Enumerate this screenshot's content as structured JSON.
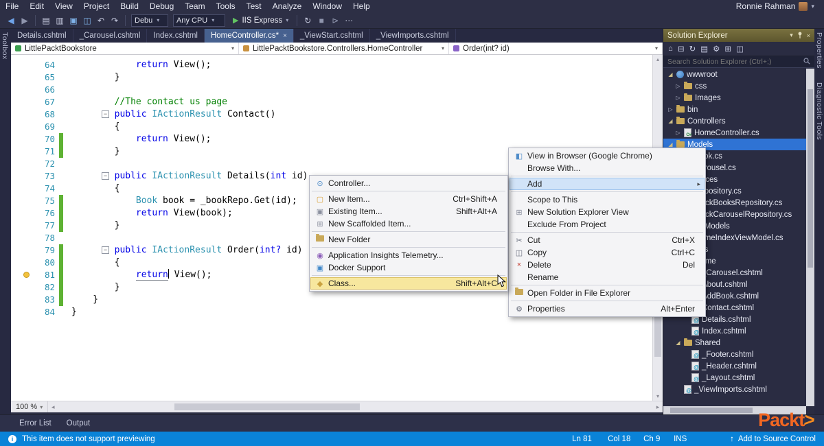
{
  "window": {
    "user_name": "Ronnie Rahman"
  },
  "menubar": [
    "File",
    "Edit",
    "View",
    "Project",
    "Build",
    "Debug",
    "Team",
    "Tools",
    "Test",
    "Analyze",
    "Window",
    "Help"
  ],
  "toolbar": {
    "nav_icons": [
      {
        "n": "back-icon",
        "g": "◀",
        "c": "#6fa3e8"
      },
      {
        "n": "forward-icon",
        "g": "▶",
        "c": "#8f95ad"
      }
    ],
    "file_icons": [
      {
        "n": "new-file-icon",
        "g": "▤",
        "c": "#c7cbe0"
      },
      {
        "n": "open-file-icon",
        "g": "▥",
        "c": "#c7cbe0"
      },
      {
        "n": "save-icon",
        "g": "▣",
        "c": "#7fb2e8"
      },
      {
        "n": "save-all-icon",
        "g": "◫",
        "c": "#7fb2e8"
      },
      {
        "n": "undo-icon",
        "g": "↶",
        "c": "#c7cbe0"
      },
      {
        "n": "redo-icon",
        "g": "↷",
        "c": "#c7cbe0"
      }
    ],
    "debug_config": "Debu",
    "platform": "Any CPU",
    "run_label": "IIS Express",
    "tail_icons": [
      {
        "n": "refresh-icon",
        "g": "↻",
        "c": "#c7cbe0"
      },
      {
        "n": "stop-icon",
        "g": "■",
        "c": "#8f95ad"
      },
      {
        "n": "step-icon",
        "g": "⊳",
        "c": "#8f95ad"
      },
      {
        "n": "more-tools-icon",
        "g": "⋯",
        "c": "#c7cbe0"
      }
    ]
  },
  "tabs": [
    {
      "label": "Details.cshtml",
      "active": false
    },
    {
      "label": "_Carousel.cshtml",
      "active": false
    },
    {
      "label": "Index.cshtml",
      "active": false
    },
    {
      "label": "HomeController.cs*",
      "active": true
    },
    {
      "label": "_ViewStart.cshtml",
      "active": false
    },
    {
      "label": "_ViewImports.cshtml",
      "active": false
    }
  ],
  "breadcrumb": {
    "segments": [
      {
        "label": "LittlePacktBookstore",
        "icon": "project-icon",
        "c": "#3b9e4f"
      },
      {
        "label": "LittlePacktBookstore.Controllers.HomeController",
        "icon": "class-icon",
        "c": "#c9913f"
      },
      {
        "label": "Order(int? id)",
        "icon": "method-icon",
        "c": "#8a63c8"
      }
    ]
  },
  "editor": {
    "zoom": "100 %",
    "lines": [
      {
        "n": 64,
        "segs": [
          [
            "p",
            "            "
          ],
          [
            "k",
            "return"
          ],
          [
            "p",
            " View();"
          ]
        ]
      },
      {
        "n": 65,
        "segs": [
          [
            "p",
            "        }"
          ]
        ]
      },
      {
        "n": 66,
        "segs": []
      },
      {
        "n": 67,
        "segs": [
          [
            "p",
            "        "
          ],
          [
            "c",
            "//The contact us page"
          ]
        ]
      },
      {
        "n": 68,
        "outline": true,
        "segs": [
          [
            "p",
            "        "
          ],
          [
            "k",
            "public"
          ],
          [
            "p",
            " "
          ],
          [
            "t",
            "IActionResult"
          ],
          [
            "p",
            " Contact()"
          ]
        ]
      },
      {
        "n": 69,
        "segs": [
          [
            "p",
            "        {"
          ]
        ]
      },
      {
        "n": 70,
        "bar": "g",
        "segs": [
          [
            "p",
            "            "
          ],
          [
            "k",
            "return"
          ],
          [
            "p",
            " View();"
          ]
        ]
      },
      {
        "n": 71,
        "bar": "g",
        "segs": [
          [
            "p",
            "        }"
          ]
        ]
      },
      {
        "n": 72,
        "segs": []
      },
      {
        "n": 73,
        "outline": true,
        "segs": [
          [
            "p",
            "        "
          ],
          [
            "k",
            "public"
          ],
          [
            "p",
            " "
          ],
          [
            "t",
            "IActionResult"
          ],
          [
            "p",
            " Details("
          ],
          [
            "k",
            "int"
          ],
          [
            "p",
            " id)"
          ]
        ]
      },
      {
        "n": 74,
        "segs": [
          [
            "p",
            "        {"
          ]
        ]
      },
      {
        "n": 75,
        "bar": "g",
        "segs": [
          [
            "p",
            "            "
          ],
          [
            "t",
            "Book"
          ],
          [
            "p",
            " book = _bookRepo.Get(id);"
          ]
        ]
      },
      {
        "n": 76,
        "bar": "g",
        "segs": [
          [
            "p",
            "            "
          ],
          [
            "k",
            "return"
          ],
          [
            "p",
            " View(book);"
          ]
        ]
      },
      {
        "n": 77,
        "bar": "g",
        "segs": [
          [
            "p",
            "        }"
          ]
        ]
      },
      {
        "n": 78,
        "segs": []
      },
      {
        "n": 79,
        "outline": true,
        "bar": "g",
        "segs": [
          [
            "p",
            "        "
          ],
          [
            "k",
            "public"
          ],
          [
            "p",
            " "
          ],
          [
            "t",
            "IActionResult"
          ],
          [
            "p",
            " Order("
          ],
          [
            "k",
            "int?"
          ],
          [
            "p",
            " id)"
          ]
        ]
      },
      {
        "n": 80,
        "bar": "g",
        "segs": [
          [
            "p",
            "        {"
          ]
        ]
      },
      {
        "n": 81,
        "bar": "g",
        "bulb": true,
        "segs": [
          [
            "p",
            "            "
          ],
          [
            "ku",
            "return"
          ],
          [
            "p",
            " View();"
          ]
        ]
      },
      {
        "n": 82,
        "bar": "g",
        "segs": [
          [
            "p",
            "        }"
          ]
        ]
      },
      {
        "n": 83,
        "bar": "g",
        "segs": [
          [
            "p",
            "    }"
          ]
        ]
      },
      {
        "n": 84,
        "segs": [
          [
            "p",
            "}"
          ]
        ]
      }
    ]
  },
  "context_menu": {
    "items": [
      {
        "label": "View in Browser (Google Chrome)",
        "icon": "browser-icon",
        "g": "◧",
        "c": "#4f8cc9"
      },
      {
        "label": "Browse With..."
      },
      {
        "sep": true
      },
      {
        "label": "Add",
        "submenu": true,
        "highlight": "blue"
      },
      {
        "sep": true
      },
      {
        "label": "Scope to This"
      },
      {
        "label": "New Solution Explorer View",
        "icon": "new-view-icon",
        "g": "⊞",
        "c": "#8a8f9e"
      },
      {
        "label": "Exclude From Project"
      },
      {
        "sep": true
      },
      {
        "label": "Cut",
        "shortcut": "Ctrl+X",
        "icon": "cut-icon",
        "g": "✂",
        "c": "#6a6f7e"
      },
      {
        "label": "Copy",
        "shortcut": "Ctrl+C",
        "icon": "copy-icon",
        "g": "◫",
        "c": "#6a6f7e"
      },
      {
        "label": "Delete",
        "shortcut": "Del",
        "icon": "delete-icon",
        "g": "×",
        "c": "#c0392b"
      },
      {
        "label": "Rename"
      },
      {
        "sep": true
      },
      {
        "label": "Open Folder in File Explorer",
        "icon": "open-folder-icon",
        "folder": true
      },
      {
        "sep": true
      },
      {
        "label": "Properties",
        "shortcut": "Alt+Enter",
        "icon": "properties-icon",
        "g": "⚙",
        "c": "#6a6f7e"
      }
    ]
  },
  "add_submenu": {
    "items": [
      {
        "label": "Controller...",
        "icon": "controller-icon",
        "g": "⊙",
        "c": "#4f8cc9"
      },
      {
        "sep": true
      },
      {
        "label": "New Item...",
        "shortcut": "Ctrl+Shift+A",
        "icon": "new-item-icon",
        "g": "▢",
        "c": "#d8a13a"
      },
      {
        "label": "Existing Item...",
        "shortcut": "Shift+Alt+A",
        "icon": "existing-item-icon",
        "g": "▣",
        "c": "#8a8f9e"
      },
      {
        "label": "New Scaffolded Item...",
        "icon": "scaffolded-item-icon",
        "g": "⊞",
        "c": "#8a8f9e"
      },
      {
        "sep": true
      },
      {
        "label": "New Folder",
        "icon": "new-folder-icon",
        "folder": true
      },
      {
        "sep": true
      },
      {
        "label": "Application Insights Telemetry...",
        "icon": "app-insights-icon",
        "g": "◉",
        "c": "#8a5bb8"
      },
      {
        "label": "Docker Support",
        "icon": "docker-icon",
        "g": "▣",
        "c": "#3f87c9"
      },
      {
        "sep": true
      },
      {
        "label": "Class...",
        "shortcut": "Shift+Alt+C",
        "icon": "class-icon",
        "g": "◆",
        "c": "#caa23f",
        "highlight": "gold"
      }
    ]
  },
  "solution_explorer": {
    "title": "Solution Explorer",
    "search_placeholder": "Search Solution Explorer (Ctrl+;)",
    "toolbar_icons": [
      {
        "n": "home-icon",
        "g": "⌂"
      },
      {
        "n": "collapse-all-icon",
        "g": "⊟"
      },
      {
        "n": "sync-with-active-document-icon",
        "g": "↻"
      },
      {
        "n": "show-all-files-icon",
        "g": "▤"
      },
      {
        "n": "properties-icon",
        "g": "⚙"
      },
      {
        "n": "new-view-icon",
        "g": "⊞"
      },
      {
        "n": "pending-changes-icon",
        "g": "◫"
      }
    ],
    "tree": [
      {
        "label": "wwwroot",
        "depth": 0,
        "icon": "globe",
        "arrow": "e"
      },
      {
        "label": "css",
        "depth": 1,
        "icon": "folder",
        "arrow": "c"
      },
      {
        "label": "Images",
        "depth": 1,
        "icon": "folder",
        "arrow": "c"
      },
      {
        "label": "bin",
        "depth": 0,
        "icon": "folder",
        "arrow": "c"
      },
      {
        "label": "Controllers",
        "depth": 0,
        "icon": "folder",
        "arrow": "e"
      },
      {
        "label": "HomeController.cs",
        "depth": 1,
        "icon": "cs",
        "arrow": "c"
      },
      {
        "label": "Models",
        "depth": 0,
        "icon": "folder",
        "arrow": "e",
        "selected": true
      },
      {
        "label": "Book.cs",
        "depth": 1,
        "icon": "cs"
      },
      {
        "label": "Carousel.cs",
        "depth": 1,
        "icon": "cs"
      },
      {
        "label": "Services",
        "depth": 0,
        "icon": "folder",
        "arrow": "e"
      },
      {
        "label": "Repository.cs",
        "depth": 1,
        "icon": "cs"
      },
      {
        "label": "MockBooksRepository.cs",
        "depth": 1,
        "icon": "cs"
      },
      {
        "label": "MockCarouselRepository.cs",
        "depth": 1,
        "icon": "cs"
      },
      {
        "label": "ViewModels",
        "depth": 0,
        "icon": "folder",
        "arrow": "e"
      },
      {
        "label": "HomeIndexViewModel.cs",
        "depth": 1,
        "icon": "cs"
      },
      {
        "label": "Views",
        "depth": 0,
        "icon": "folder",
        "arrow": "e"
      },
      {
        "label": "Home",
        "depth": 1,
        "icon": "folder",
        "arrow": "e"
      },
      {
        "label": "_Carousel.cshtml",
        "depth": 2,
        "icon": "razor"
      },
      {
        "label": "About.cshtml",
        "depth": 2,
        "icon": "razor"
      },
      {
        "label": "AddBook.cshtml",
        "depth": 2,
        "icon": "razor"
      },
      {
        "label": "Contact.cshtml",
        "depth": 2,
        "icon": "razor"
      },
      {
        "label": "Details.cshtml",
        "depth": 2,
        "icon": "razor"
      },
      {
        "label": "Index.cshtml",
        "depth": 2,
        "icon": "razor"
      },
      {
        "label": "Shared",
        "depth": 1,
        "icon": "folder",
        "arrow": "e"
      },
      {
        "label": "_Footer.cshtml",
        "depth": 2,
        "icon": "razor"
      },
      {
        "label": "_Header.cshtml",
        "depth": 2,
        "icon": "razor"
      },
      {
        "label": "_Layout.cshtml",
        "depth": 2,
        "icon": "razor"
      },
      {
        "label": "_ViewImports.cshtml",
        "depth": 1,
        "icon": "razor"
      }
    ]
  },
  "bottom_panel": {
    "tabs": [
      "Error List",
      "Output"
    ]
  },
  "status_bar": {
    "message": "This item does not support previewing",
    "line": "Ln 81",
    "column": "Col 18",
    "character": "Ch 9",
    "mode": "INS",
    "source_control": "Add to Source Control"
  },
  "side_strips": {
    "left": "Toolbox",
    "right": [
      "Properties",
      "Diagnostic Tools"
    ]
  },
  "logo": {
    "brand": "Packt",
    "arrow": ">"
  }
}
